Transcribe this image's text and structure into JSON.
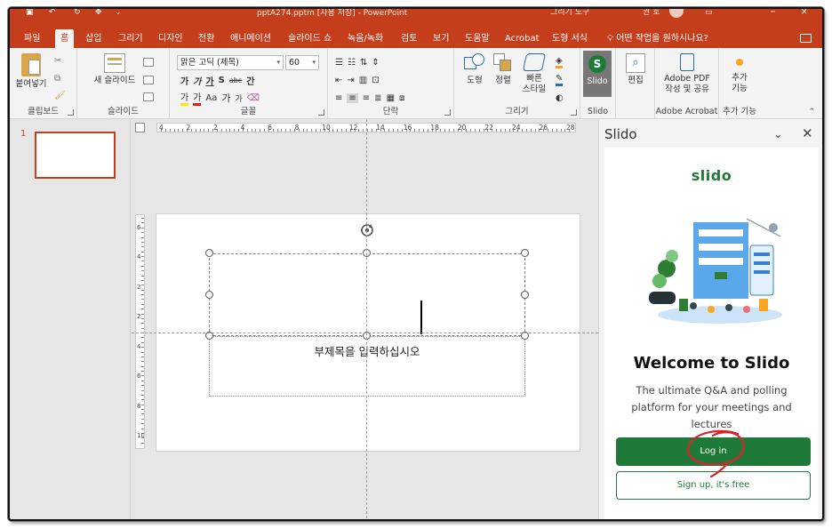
{
  "window": {
    "title": "pptA274.pptm [사용 저장] - PowerPoint",
    "context_label": "그리기 도구",
    "user_fragment": "권 호",
    "accent": "#c43e1c"
  },
  "tabs": [
    {
      "label": "파일"
    },
    {
      "label": "홈"
    },
    {
      "label": "삽입"
    },
    {
      "label": "그리기"
    },
    {
      "label": "디자인"
    },
    {
      "label": "전환"
    },
    {
      "label": "애니메이션"
    },
    {
      "label": "슬라이드 쇼"
    },
    {
      "label": "녹음/녹화"
    },
    {
      "label": "검토"
    },
    {
      "label": "보기"
    },
    {
      "label": "도움말"
    },
    {
      "label": "Acrobat"
    },
    {
      "label": "도형 서식"
    }
  ],
  "tell_me": "어떤 작업을 원하시나요?",
  "ribbon": {
    "clipboard": {
      "paste": "붙여넣기",
      "label": "클립보드"
    },
    "slides": {
      "new_slide": "새 슬라이드",
      "label": "슬라이드"
    },
    "font": {
      "font_name": "맑은 고딕 (제목)",
      "font_size": "60",
      "row2": [
        "가",
        "가",
        "가",
        "S",
        "abc",
        "간"
      ],
      "row3": [
        "가",
        "가",
        "Aa",
        "가",
        "가"
      ],
      "label": "글꼴"
    },
    "paragraph": {
      "label": "단락"
    },
    "drawing": {
      "shapes": "도형",
      "arrange": "정렬",
      "quick_styles_1": "빠른",
      "quick_styles_2": "스타일",
      "label": "그리기"
    },
    "slido": {
      "button": "Slido",
      "label": "Slido"
    },
    "editing": {
      "label": "편집"
    },
    "adobe": {
      "line1": "Adobe PDF",
      "line2": "작성 및 공유",
      "label": "Adobe Acrobat"
    },
    "addins": {
      "line1": "추가",
      "line2": "기능",
      "label": "추가 기능"
    }
  },
  "thumbnails": [
    {
      "number": "1"
    }
  ],
  "ruler": {
    "h_numbers": [
      "4",
      "2",
      "2",
      "4",
      "6",
      "8",
      "10",
      "12",
      "14",
      "16",
      "18",
      "20",
      "22",
      "24",
      "26",
      "28"
    ],
    "v_numbers": [
      "6",
      "4",
      "2",
      "2",
      "4",
      "6",
      "8",
      "10"
    ]
  },
  "slide": {
    "subtitle_placeholder": "부제목을 입력하십시오"
  },
  "slido": {
    "pane_title": "Slido",
    "logo": "slido",
    "welcome": "Welcome to Slido",
    "description": "The ultimate Q&A and polling platform for your meetings and lectures",
    "login": "Log in",
    "signup": "Sign up, it's free",
    "brand_color": "#1f7a39"
  }
}
